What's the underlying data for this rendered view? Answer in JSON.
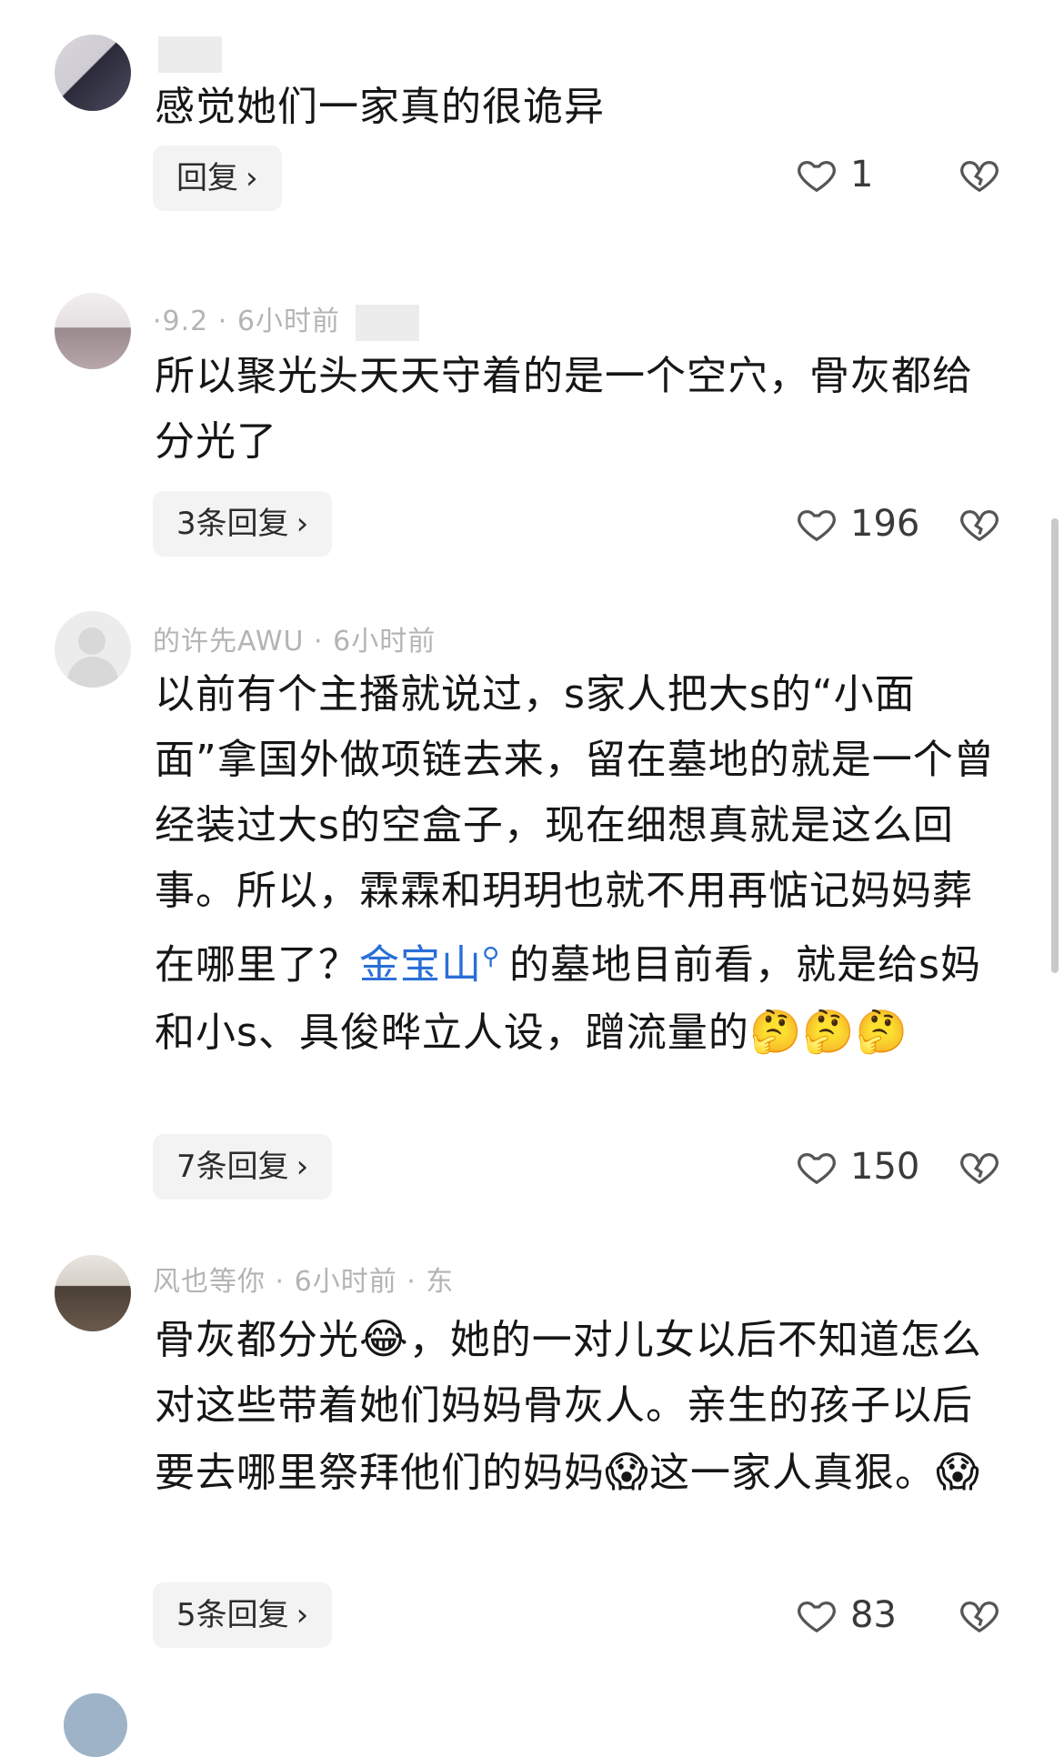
{
  "comments": [
    {
      "meta": "",
      "text": "感觉她们一家真的很诡异",
      "reply_label": "回复",
      "likes": "1"
    },
    {
      "meta": "·9.2 · 6小时前",
      "text": "所以聚光头天天守着的是一个空穴，骨灰都给分光了",
      "reply_label": "3条回复",
      "likes": "196"
    },
    {
      "meta": "的许先AWU · 6小时前",
      "text_before": "以前有个主播就说过，s家人把大s的“小面面”拿国外做项链去来，留在墓地的就是一个曾经装过大s的空盒子，现在细想真就是这么回事。所以，霖霖和玥玥也就不用再惦记妈妈葬在哪里了？",
      "link": "金宝山",
      "text_after": "的墓地目前看，就是给s妈和小s、具俊晔立人设，蹭流量的",
      "emoji": "🤔🤔🤔",
      "reply_label": "7条回复",
      "likes": "150"
    },
    {
      "meta": "风也等你 · 6小时前 · 东",
      "text_1": "骨灰都分光",
      "emoji_1": "😂",
      "text_2": "，她的一对儿女以后不知道怎么对这些带着她们妈妈骨灰人。亲生的孩子以后要去哪里祭拜他们的妈妈",
      "emoji_2": "😱",
      "text_3": "这一家人真狠。",
      "emoji_3": "😱",
      "reply_label": "5条回复",
      "likes": "83"
    }
  ],
  "icons": {
    "like": "heart-outline-icon",
    "dislike": "broken-heart-icon",
    "reply_chevron": "chevron-right-icon",
    "search": "search-icon"
  },
  "colors": {
    "link": "#2a6fd6",
    "text": "#161616",
    "meta": "#b4b4b4",
    "reply_bg": "#f3f3f3"
  }
}
